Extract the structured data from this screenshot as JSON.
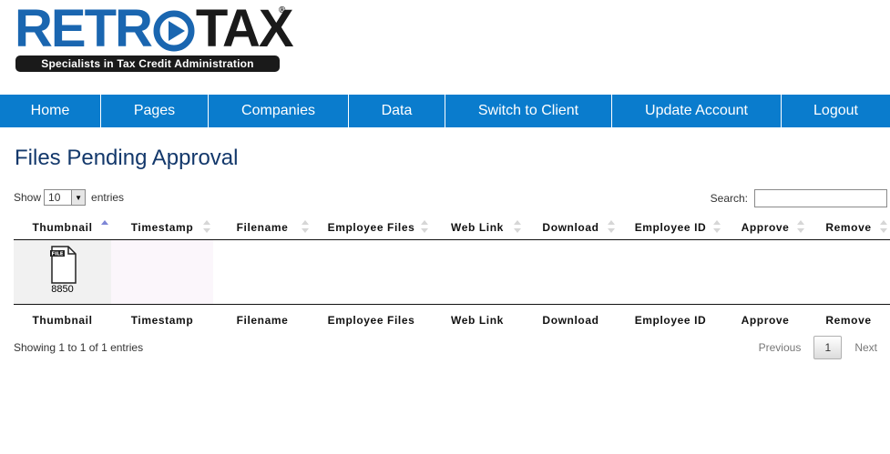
{
  "brand": {
    "logo_part1": "RETR",
    "logo_part2": "TAX",
    "registered": "®",
    "tagline": "Specialists in Tax Credit Administration",
    "colors": {
      "blue": "#1a66b0",
      "dark": "#1a1a1a"
    }
  },
  "nav": {
    "background": "#0a7ccd",
    "items": [
      {
        "label": "Home"
      },
      {
        "label": "Pages"
      },
      {
        "label": "Companies"
      },
      {
        "label": "Data"
      },
      {
        "label": "Switch to Client"
      },
      {
        "label": "Update Account"
      },
      {
        "label": "Logout"
      }
    ]
  },
  "page": {
    "title": "Files Pending Approval"
  },
  "length_menu": {
    "show_label": "Show",
    "value": "10",
    "entries_label": "entries"
  },
  "search": {
    "label": "Search:",
    "value": ""
  },
  "table": {
    "columns": [
      {
        "label": "Thumbnail",
        "sort": "asc"
      },
      {
        "label": "Timestamp",
        "sort": "none"
      },
      {
        "label": "Filename",
        "sort": "none"
      },
      {
        "label": "Employee Files",
        "sort": "none"
      },
      {
        "label": "Web Link",
        "sort": "none"
      },
      {
        "label": "Download",
        "sort": "none"
      },
      {
        "label": "Employee ID",
        "sort": "none"
      },
      {
        "label": "Approve",
        "sort": "none"
      },
      {
        "label": "Remove",
        "sort": "none"
      }
    ],
    "rows": [
      {
        "thumbnail": {
          "icon": "file-icon",
          "badge": "FILE",
          "label": "8850"
        },
        "timestamp": "",
        "filename": "",
        "employee_files": "",
        "web_link": "",
        "download": "",
        "employee_id": "",
        "approve": "",
        "remove": ""
      }
    ]
  },
  "info": "Showing 1 to 1 of 1 entries",
  "pagination": {
    "previous": "Previous",
    "current": "1",
    "next": "Next"
  }
}
